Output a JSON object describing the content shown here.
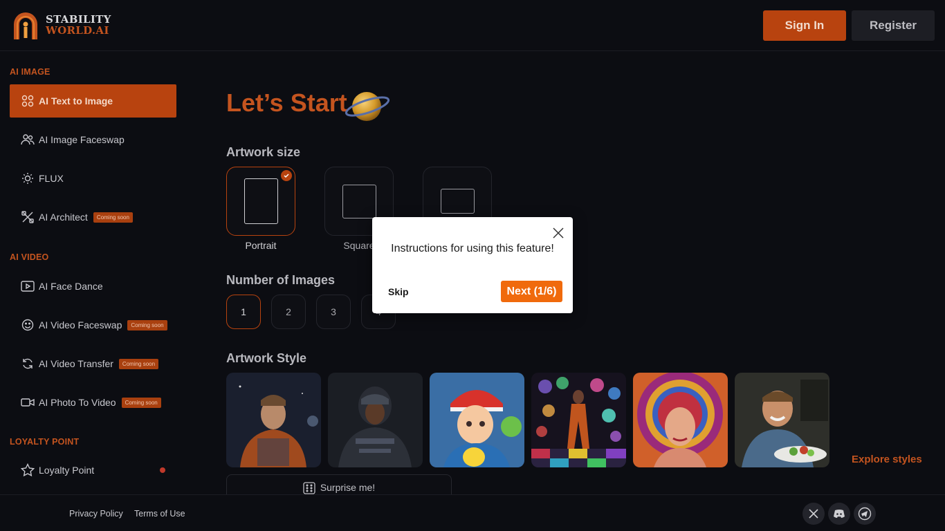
{
  "header": {
    "logo_line1": "STABILITY",
    "logo_line2": "WORLD.AI",
    "signin_label": "Sign In",
    "register_label": "Register"
  },
  "sidebar": {
    "sections": [
      {
        "title": "AI IMAGE"
      },
      {
        "title": "AI VIDEO"
      },
      {
        "title": "LOYALTY POINT"
      }
    ],
    "items": [
      {
        "label": "AI Text to Image",
        "icon": "grid-icon",
        "active": true
      },
      {
        "label": "AI Image Faceswap",
        "icon": "users-icon"
      },
      {
        "label": "FLUX",
        "icon": "sun-icon"
      },
      {
        "label": "AI Architect",
        "icon": "tools-icon",
        "badge": "Coming soon"
      },
      {
        "label": "AI Face Dance",
        "icon": "play-icon"
      },
      {
        "label": "AI Video Faceswap",
        "icon": "smile-icon",
        "badge": "Coming soon"
      },
      {
        "label": "AI Video Transfer",
        "icon": "refresh-icon",
        "badge": "Coming soon"
      },
      {
        "label": "AI Photo To Video",
        "icon": "video-camera-icon",
        "badge": "Coming soon"
      },
      {
        "label": "Loyalty Point",
        "icon": "star-icon"
      }
    ]
  },
  "main": {
    "title": "Let’s Start",
    "artwork_size_heading": "Artwork size",
    "sizes": [
      {
        "label": "Portrait",
        "selected": true
      },
      {
        "label": "Square"
      },
      {
        "label": ""
      }
    ],
    "num_images_heading": "Number of Images",
    "num_options": [
      "1",
      "2",
      "3",
      "4"
    ],
    "num_selected": "1",
    "artwork_style_heading": "Artwork Style",
    "explore_label": "Explore styles",
    "surprise_label": "Surprise me!"
  },
  "footer": {
    "privacy": "Privacy Policy",
    "terms": "Terms of Use",
    "socials": [
      "x-icon",
      "discord-icon",
      "telegram-icon"
    ]
  },
  "tour": {
    "message": "Instructions for using this feature!",
    "skip_label": "Skip",
    "next_label": "Next (1/6)"
  },
  "colors": {
    "accent": "#b8430f",
    "accent_text": "#c4541f",
    "background": "#0c0d12",
    "next_button": "#f06a0c"
  }
}
